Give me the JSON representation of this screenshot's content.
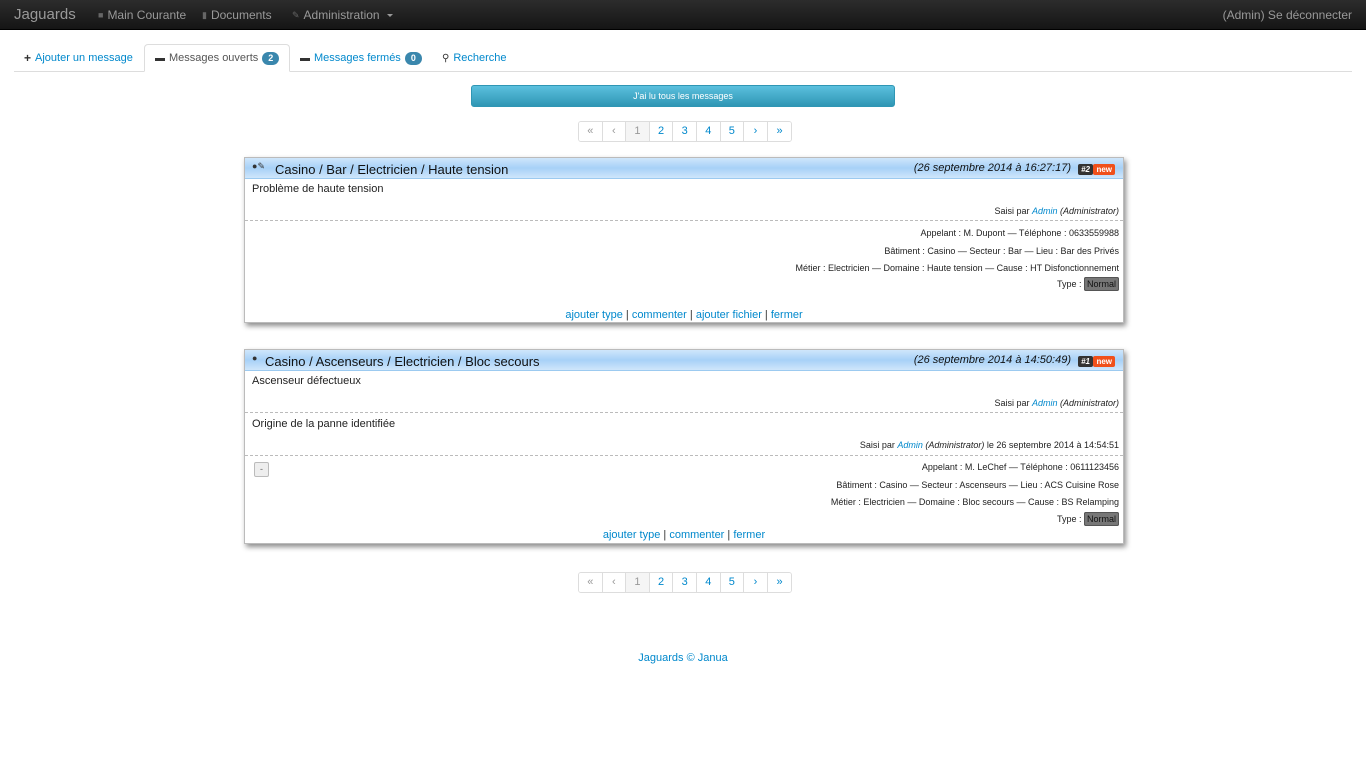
{
  "navbar": {
    "brand": "Jaguards",
    "items": [
      {
        "label": "Main Courante",
        "icon": "comment-icon"
      },
      {
        "label": "Documents",
        "icon": "book-icon"
      },
      {
        "label": "Administration",
        "icon": "wrench-icon"
      }
    ],
    "logout": "(Admin) Se déconnecter"
  },
  "tabs": [
    {
      "label": "Ajouter un message",
      "icon": "plus-icon"
    },
    {
      "label": "Messages ouverts",
      "icon": "folder-open-icon",
      "count": "2",
      "active": true
    },
    {
      "label": "Messages fermés",
      "icon": "folder-icon",
      "count": "0"
    },
    {
      "label": "Recherche",
      "icon": "search-icon"
    }
  ],
  "read_all_button": "J'ai lu tous les messages",
  "pagination": {
    "first": "«",
    "prev": "‹",
    "pages": [
      "1",
      "2",
      "3",
      "4",
      "5"
    ],
    "next": "›",
    "last": "»",
    "current": 1
  },
  "messages": [
    {
      "title": "Casino / Bar / Electricien / Haute tension",
      "date": "(26 septembre 2014 à 16:27:17)",
      "number": "#2",
      "badge": "new",
      "body": "Problème de haute tension",
      "entered_by_prefix": "Saisi par ",
      "entered_by_user": "Admin",
      "entered_by_role": " (Administrator)",
      "caller": "Appelant : M. Dupont — Téléphone : 0633559988",
      "location": "Bâtiment : Casino — Secteur : Bar — Lieu : Bar des Privés",
      "trade": "Métier : Electricien — Domaine : Haute tension — Cause : HT Disfonctionnement",
      "type_label": "Type : ",
      "type_value": "Normal",
      "actions": [
        "ajouter type",
        "commenter",
        "ajouter fichier",
        "fermer"
      ]
    },
    {
      "title": "Casino / Ascenseurs / Electricien / Bloc secours",
      "date": "(26 septembre 2014 à 14:50:49)",
      "number": "#1",
      "badge": "new",
      "body": "Ascenseur défectueux",
      "entered_by_prefix": "Saisi par ",
      "entered_by_user": "Admin",
      "entered_by_role": " (Administrator)",
      "comment": "Origine de la panne identifiée",
      "comment_by_prefix": "Saisi par ",
      "comment_by_user": "Admin",
      "comment_by_role": " (Administrator)",
      "comment_by_date": " le 26 septembre 2014 à 14:54:51",
      "toggle": "-",
      "caller": "Appelant : M. LeChef — Téléphone : 0611123456",
      "location": "Bâtiment : Casino — Secteur : Ascenseurs — Lieu : ACS Cuisine Rose",
      "trade": "Métier : Electricien — Domaine : Bloc secours — Cause : BS Relamping",
      "type_label": "Type : ",
      "type_value": "Normal",
      "actions": [
        "ajouter type",
        "commenter",
        "fermer"
      ]
    }
  ],
  "footer": "Jaguards © Janua"
}
